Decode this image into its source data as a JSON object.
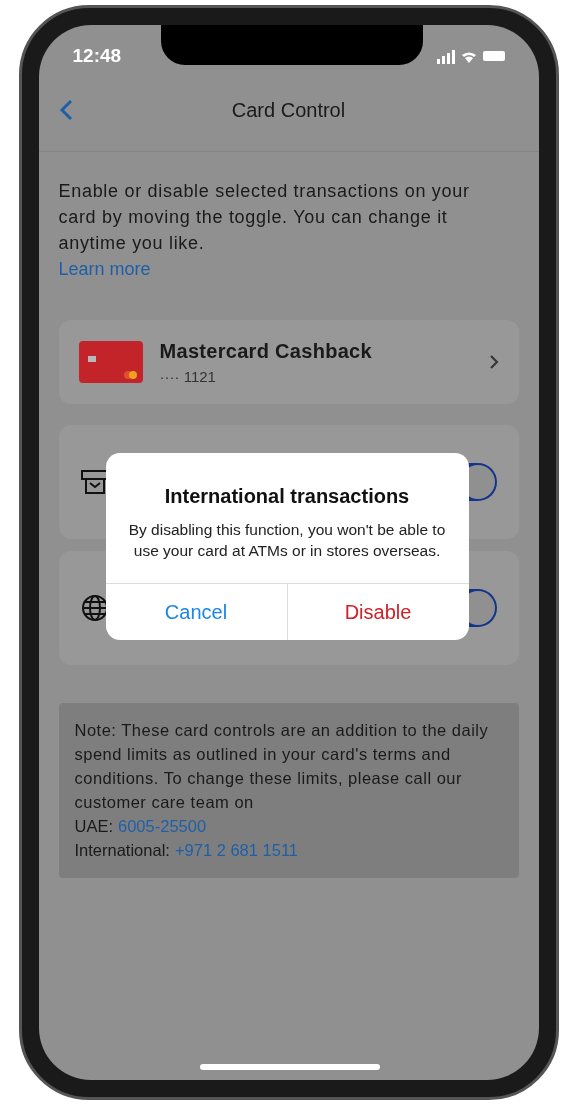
{
  "status_bar": {
    "time": "12:48"
  },
  "nav": {
    "title": "Card Control"
  },
  "intro": {
    "text": "Enable or disable selected transactions on your card by moving the toggle. You can change it anytime you like.",
    "link": "Learn more"
  },
  "card": {
    "name": "Mastercard Cashback",
    "number": "···· 1121"
  },
  "controls": [
    {
      "kind": "atm",
      "on": true
    },
    {
      "kind": "globe",
      "on": true
    }
  ],
  "note": {
    "text": "Note: These card controls are an addition to the daily spend limits as outlined in your card's terms and conditions. To change these limits, please call our customer care team on",
    "contacts": [
      {
        "label": "UAE:",
        "phone": "6005-25500"
      },
      {
        "label": "International:",
        "phone": "+971 2 681 1511"
      }
    ]
  },
  "dialog": {
    "title": "International transactions",
    "message": "By disabling this function, you won't be able to use your card at ATMs or in stores overseas.",
    "buttons": [
      {
        "label": "Cancel",
        "kind": "cancel"
      },
      {
        "label": "Disable",
        "kind": "destructive"
      }
    ]
  }
}
